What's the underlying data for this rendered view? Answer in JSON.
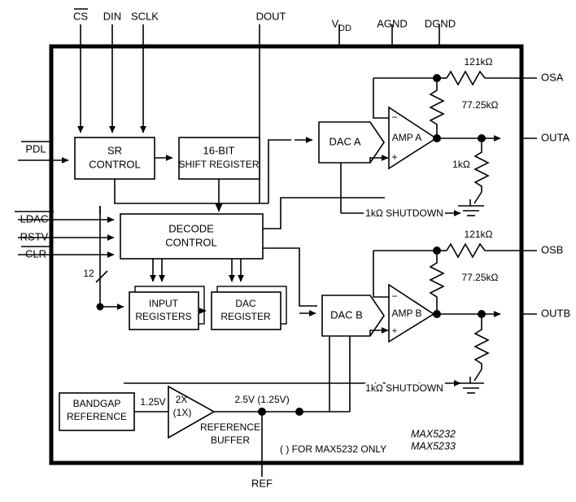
{
  "diagram": {
    "title_parts": [
      "MAX5232",
      "MAX5233"
    ],
    "footnote": "(  ) FOR MAX5232 ONLY",
    "bus_width": "12"
  },
  "pins": {
    "top": [
      {
        "name": "CS",
        "overbar": true
      },
      {
        "name": "DIN",
        "overbar": false
      },
      {
        "name": "SCLK",
        "overbar": false
      },
      {
        "name": "DOUT",
        "overbar": false
      },
      {
        "name": "VDD",
        "overbar": false,
        "display": "V",
        "sub": "DD"
      },
      {
        "name": "AGND",
        "overbar": false
      },
      {
        "name": "DGND",
        "overbar": false
      }
    ],
    "left": [
      {
        "name": "PDL",
        "overbar": true
      },
      {
        "name": "LDAC",
        "overbar": true
      },
      {
        "name": "RSTV",
        "overbar": false
      },
      {
        "name": "CLR",
        "overbar": true
      }
    ],
    "right": [
      {
        "name": "OSA"
      },
      {
        "name": "OUTA"
      },
      {
        "name": "OSB"
      },
      {
        "name": "OUTB"
      }
    ],
    "bottom": [
      {
        "name": "REF"
      }
    ]
  },
  "blocks": {
    "sr_control": [
      "SR",
      "CONTROL"
    ],
    "shift_register": [
      "16-BIT",
      "SHIFT REGISTER"
    ],
    "decode_control": [
      "DECODE",
      "CONTROL"
    ],
    "input_registers": [
      "INPUT",
      "REGISTERS"
    ],
    "dac_register": [
      "DAC",
      "REGISTER"
    ],
    "bandgap_reference": [
      "BANDGAP",
      "REFERENCE"
    ],
    "dac_a": "DAC A",
    "dac_b": "DAC B",
    "amp_a": "AMP A",
    "amp_b": "AMP B",
    "ref_buffer_gain": [
      "2X",
      "(1X)"
    ],
    "ref_buffer_label": [
      "REFERENCE",
      "BUFFER"
    ]
  },
  "values": {
    "r_top_a": "121kΩ",
    "r_fb_a": "77.25kΩ",
    "r_load_a": "1kΩ",
    "r_top_b": "121kΩ",
    "r_fb_b": "77.25kΩ",
    "shutdown_a": "1kΩ SHUTDOWN",
    "shutdown_b": "1kΩ SHUTDOWN",
    "bandgap_out": "1.25V",
    "ref_out": "2.5V (1.25V)"
  },
  "amp_signs": {
    "minus": "−",
    "plus": "+"
  },
  "colors": {
    "line": "#000000",
    "frame": "#000000",
    "background": "#ffffff"
  }
}
